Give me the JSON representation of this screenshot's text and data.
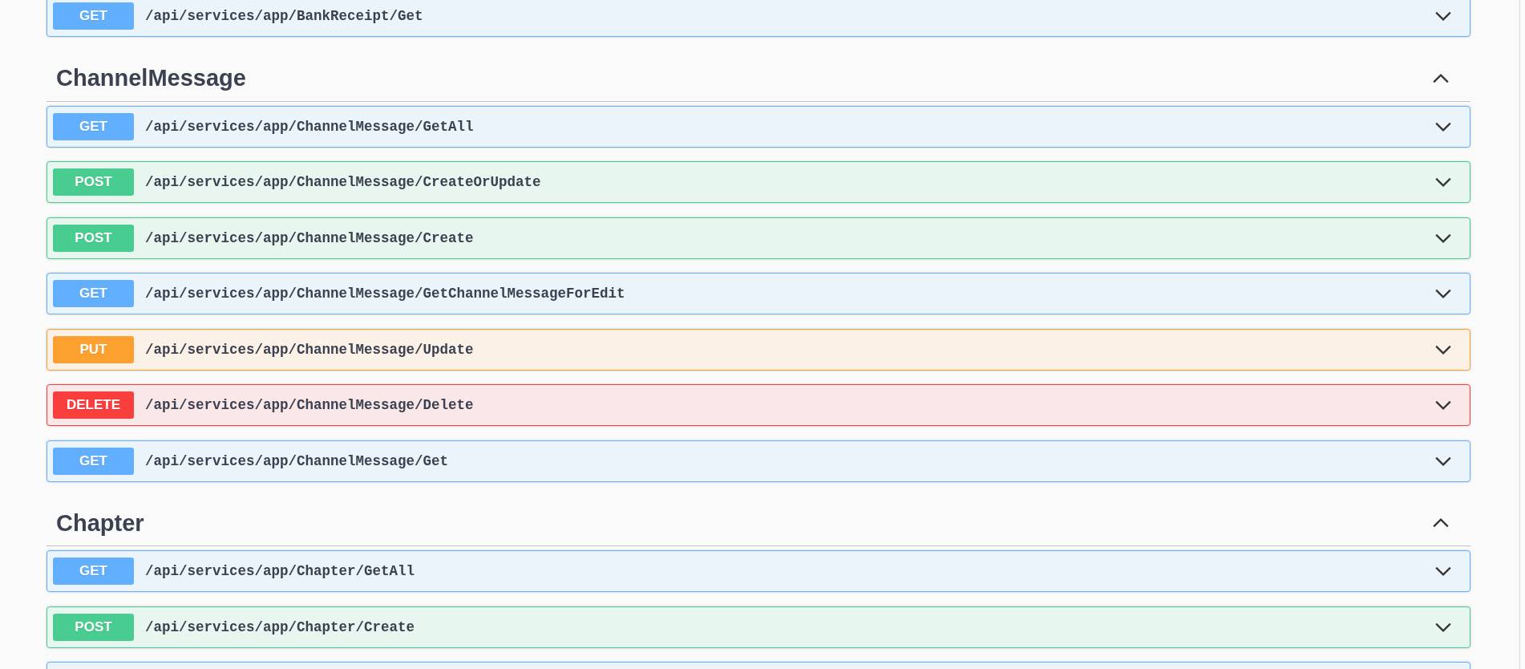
{
  "leading_operations": [
    {
      "method": "GET",
      "path": "/api/services/app/BankReceipt/Get",
      "expanded": false
    }
  ],
  "sections": [
    {
      "name": "ChannelMessage",
      "expanded": true,
      "operations": [
        {
          "method": "GET",
          "path": "/api/services/app/ChannelMessage/GetAll",
          "expanded": false
        },
        {
          "method": "POST",
          "path": "/api/services/app/ChannelMessage/CreateOrUpdate",
          "expanded": false
        },
        {
          "method": "POST",
          "path": "/api/services/app/ChannelMessage/Create",
          "expanded": false
        },
        {
          "method": "GET",
          "path": "/api/services/app/ChannelMessage/GetChannelMessageForEdit",
          "expanded": false
        },
        {
          "method": "PUT",
          "path": "/api/services/app/ChannelMessage/Update",
          "expanded": false
        },
        {
          "method": "DELETE",
          "path": "/api/services/app/ChannelMessage/Delete",
          "expanded": false
        },
        {
          "method": "GET",
          "path": "/api/services/app/ChannelMessage/Get",
          "expanded": false
        }
      ]
    },
    {
      "name": "Chapter",
      "expanded": true,
      "operations": [
        {
          "method": "GET",
          "path": "/api/services/app/Chapter/GetAll",
          "expanded": false
        },
        {
          "method": "POST",
          "path": "/api/services/app/Chapter/Create",
          "expanded": false
        }
      ]
    }
  ]
}
